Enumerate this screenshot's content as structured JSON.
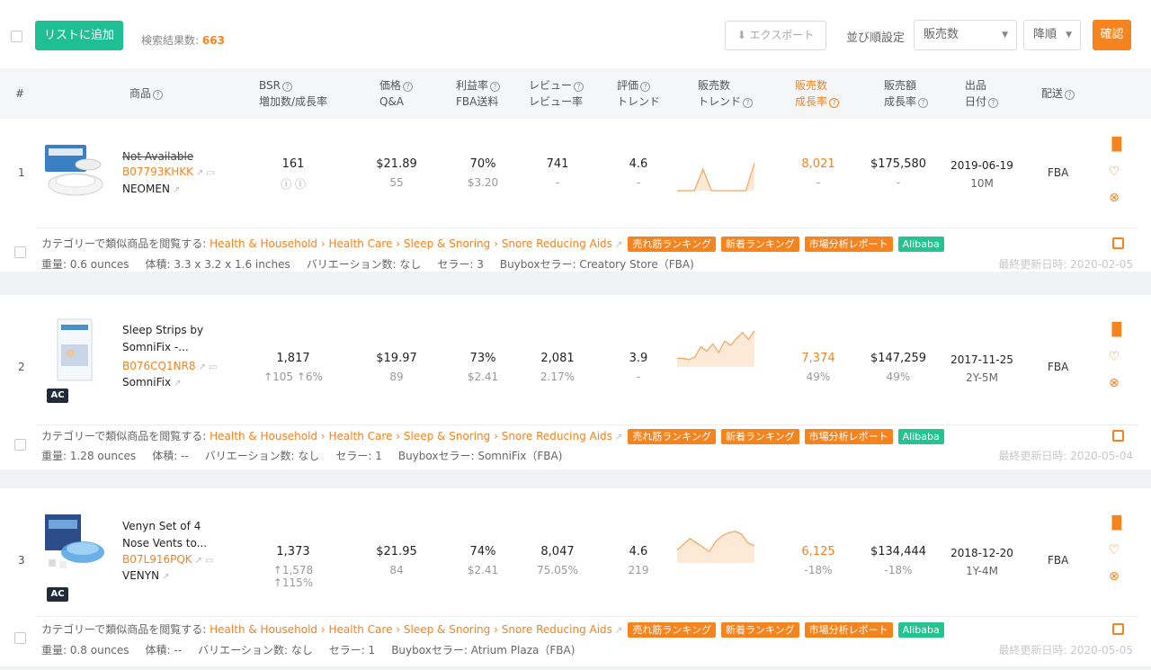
{
  "toolbar": {
    "add_to_list": "リストに追加",
    "result_label": "検索結果数:",
    "result_count": "663",
    "export_label": "エクスポート",
    "sort_label": "並び順設定",
    "sort_field": "販売数",
    "sort_order": "降順",
    "confirm_label": "確認"
  },
  "header": {
    "num": "#",
    "product": "商品",
    "bsr_1": "BSR",
    "bsr_2": "増加数/成長率",
    "price_1": "価格",
    "price_2": "Q&A",
    "margin_1": "利益率",
    "margin_2": "FBA送料",
    "review_1": "レビュー",
    "review_2": "レビュー率",
    "rating_1": "評価",
    "rating_2": "トレンド",
    "sales_trend_1": "販売数",
    "sales_trend_2": "トレンド",
    "sales_growth_1": "販売数",
    "sales_growth_2": "成長率",
    "revenue_1": "販売額",
    "revenue_2": "成長率",
    "date_1": "出品",
    "date_2": "日付",
    "shipping": "配送"
  },
  "common": {
    "category_prefix": "カテゴリーで類似商品を閲覧する: ",
    "category_path": "Health & Household › Health Care › Sleep & Snoring › Snore Reducing Aids",
    "tag_bestseller": "売れ筋ランキング",
    "tag_new": "新着ランキング",
    "tag_report": "市場分析レポート",
    "tag_alibaba": "Alibaba"
  },
  "products": [
    {
      "rank": "1",
      "name": "Not Available",
      "asin": "B07793KHKK",
      "brand": "NEOMEN",
      "bsr": "161",
      "bsr_change": "",
      "price": "$21.89",
      "qa": "55",
      "margin": "70%",
      "fba_fee": "$3.20",
      "reviews": "741",
      "review_rate": "-",
      "rating": "4.6",
      "rating_trend": "-",
      "sales": "8,021",
      "sales_growth": "-",
      "revenue": "$175,580",
      "revenue_growth": "-",
      "date": "2019-06-19",
      "age": "10M",
      "shipping": "FBA",
      "ac": false,
      "trend": [
        0,
        0,
        0,
        30,
        0,
        0,
        0,
        0,
        0,
        38
      ],
      "weight": "重量: 0.6 ounces",
      "size": "体積: 3.3 x 3.2 x 1.6 inches",
      "variations": "バリエーション数: なし",
      "sellers": "セラー: 3",
      "buybox": "Buyboxセラー:  Creatory Store（FBA)",
      "updated": "最終更新日時: 2020-02-05"
    },
    {
      "rank": "2",
      "name": "Sleep Strips by SomniFix -...",
      "asin": "B076CQ1NR8",
      "brand": "SomniFix",
      "bsr": "1,817",
      "bsr_change": "↑105  ↑6%",
      "price": "$19.97",
      "qa": "89",
      "margin": "73%",
      "fba_fee": "$2.41",
      "reviews": "2,081",
      "review_rate": "2.17%",
      "rating": "3.9",
      "rating_trend": "-",
      "sales": "7,374",
      "sales_growth": "49%",
      "revenue": "$147,259",
      "revenue_growth": "49%",
      "date": "2017-11-25",
      "age": "2Y-5M",
      "shipping": "FBA",
      "ac": true,
      "trend": [
        12,
        12,
        10,
        14,
        28,
        22,
        32,
        20,
        36,
        30,
        40,
        48,
        38,
        50
      ],
      "weight": "重量: 1.28 ounces",
      "size": "体積: --",
      "variations": "バリエーション数: なし",
      "sellers": "セラー: 1",
      "buybox": "Buyboxセラー:  SomniFix（FBA)",
      "updated": "最終更新日時: 2020-05-04"
    },
    {
      "rank": "3",
      "name": "Venyn Set of 4 Nose Vents to...",
      "asin": "B07L916PQK",
      "brand": "VENYN",
      "bsr": "1,373",
      "bsr_change": "↑1,578  ↑115%",
      "price": "$21.95",
      "qa": "84",
      "margin": "74%",
      "fba_fee": "$2.41",
      "reviews": "8,047",
      "review_rate": "75.05%",
      "rating": "4.6",
      "rating_trend": "219",
      "sales": "6,125",
      "sales_growth": "-18%",
      "revenue": "$134,444",
      "revenue_growth": "-18%",
      "date": "2018-12-20",
      "age": "1Y-4M",
      "shipping": "FBA",
      "ac": true,
      "trend": [
        18,
        26,
        34,
        28,
        22,
        16,
        30,
        38,
        42,
        44,
        40,
        28,
        24
      ],
      "weight": "重量: 0.8 ounces",
      "size": "体積: --",
      "variations": "バリエーション数: なし",
      "sellers": "セラー: 1",
      "buybox": "Buyboxセラー:  Atrium Plaza（FBA)",
      "updated": "最終更新日時: 2020-05-05"
    }
  ]
}
